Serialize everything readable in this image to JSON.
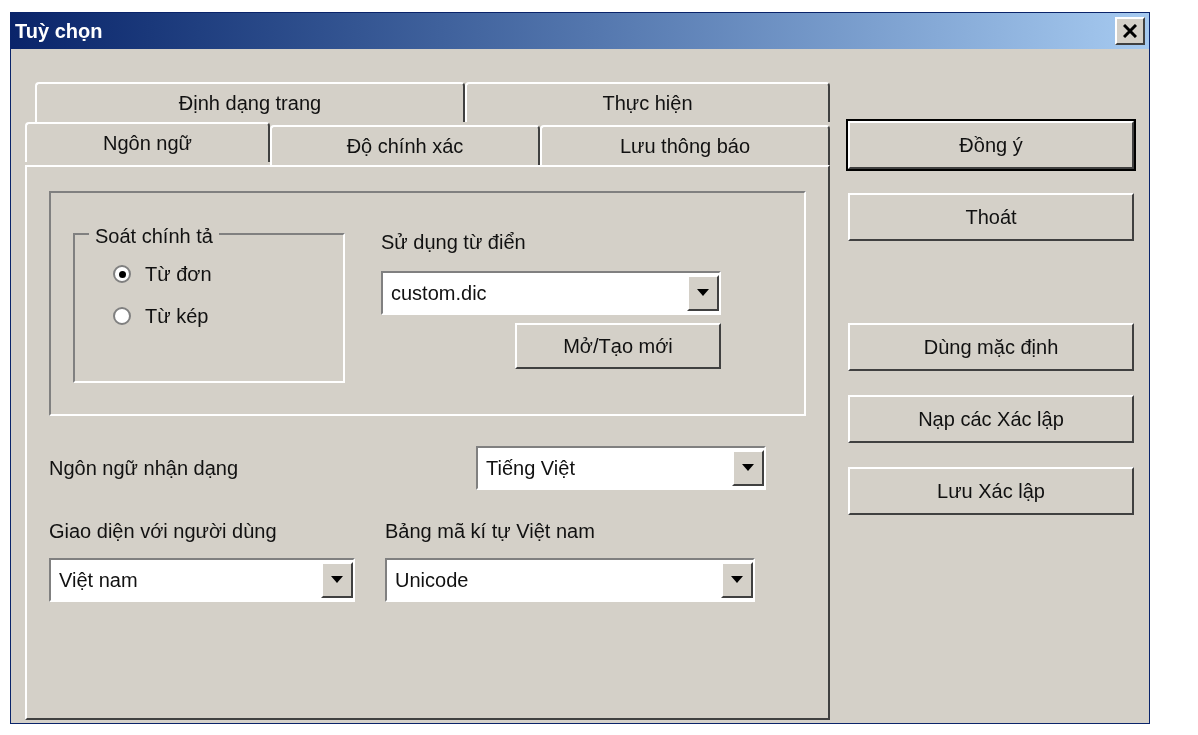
{
  "window": {
    "title": "Tuỳ chọn"
  },
  "tab_rows": [
    [
      {
        "label": "Định dạng trang",
        "selected": false
      },
      {
        "label": "Thực hiện",
        "selected": false
      }
    ],
    [
      {
        "label": "Ngôn ngữ",
        "selected": true
      },
      {
        "label": "Độ chính xác",
        "selected": false
      },
      {
        "label": "Lưu thông báo",
        "selected": false
      }
    ]
  ],
  "spelling": {
    "title": "Soát chính tả",
    "options": [
      {
        "label": "Từ đơn",
        "selected": true
      },
      {
        "label": "Từ kép",
        "selected": false
      }
    ]
  },
  "dictionary": {
    "label": "Sử dụng từ điển",
    "value": "custom.dic",
    "button": "Mở/Tạo mới"
  },
  "recognition_language": {
    "label": "Ngôn ngữ nhận dạng",
    "value": "Tiếng Việt"
  },
  "ui_language": {
    "label": "Giao diện với người dùng",
    "value": "Việt nam"
  },
  "charset": {
    "label": "Bảng mã kí tự Việt nam",
    "value": "Unicode"
  },
  "buttons": [
    {
      "label": "Đồng ý",
      "default": true
    },
    {
      "label": "Thoát",
      "default": false
    },
    {
      "label": "Dùng mặc định",
      "default": false
    },
    {
      "label": "Nạp các Xác lập",
      "default": false
    },
    {
      "label": "Lưu Xác lập",
      "default": false
    }
  ]
}
